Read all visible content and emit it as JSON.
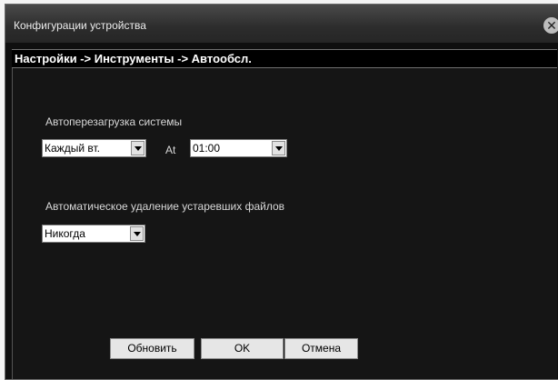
{
  "window": {
    "title": "Конфигурации устройства",
    "close_glyph": "✕",
    "close_icon": "close-icon"
  },
  "breadcrumb": "Настройки -> Инструменты -> Автообсл.",
  "reboot": {
    "label": "Автоперезагрузка системы",
    "day_value": "Каждый вт.",
    "at_label": "At",
    "time_value": "01:00"
  },
  "delete_files": {
    "label": "Автоматическое удаление устаревших файлов",
    "value": "Никогда"
  },
  "buttons": {
    "refresh": "Обновить",
    "ok": "OK",
    "cancel": "Отмена"
  }
}
